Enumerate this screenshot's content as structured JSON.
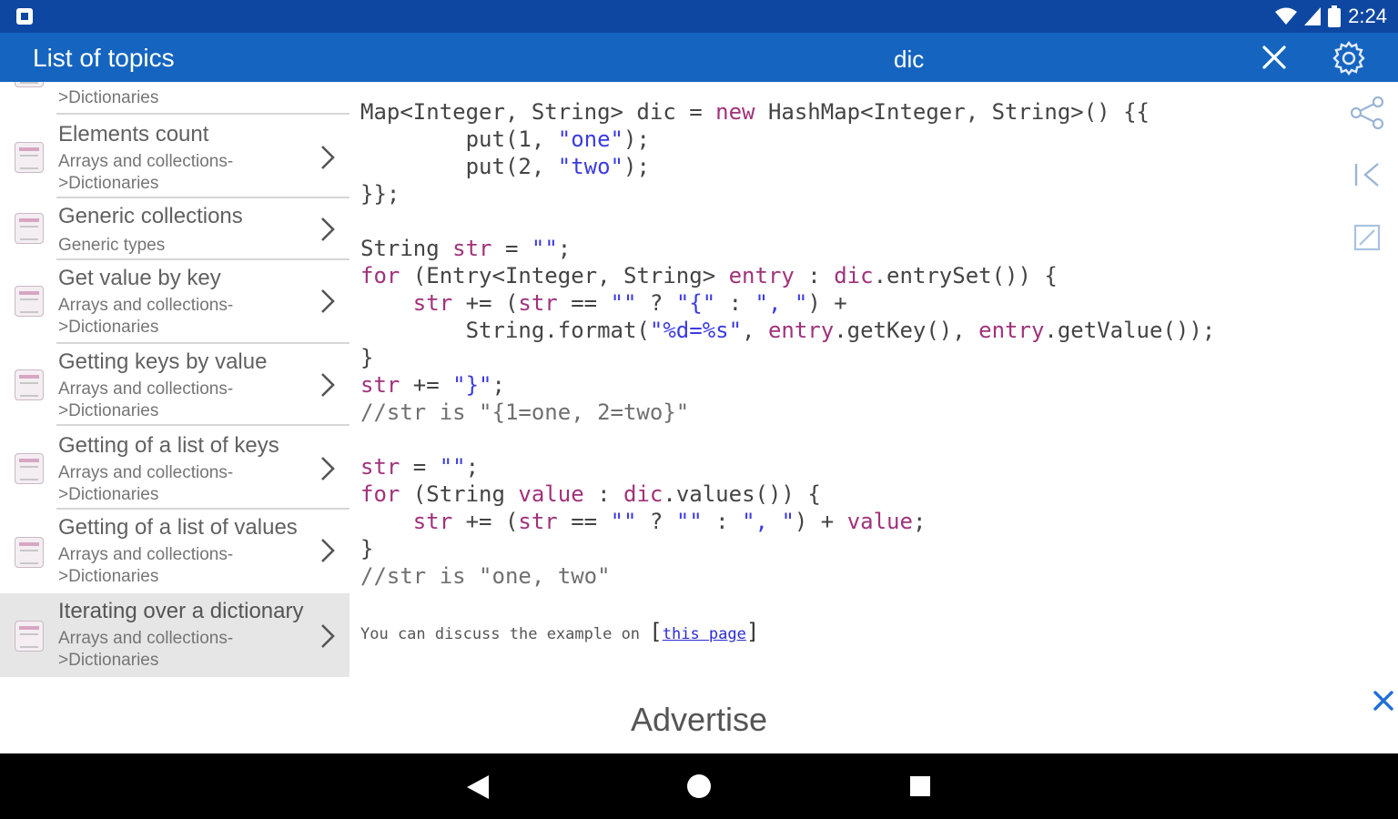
{
  "status_bar": {
    "time": "2:24"
  },
  "app_bar": {
    "title": "List of topics",
    "search_query": "dic"
  },
  "list": {
    "items": [
      {
        "subtitle": ">Dictionaries"
      },
      {
        "title": "Elements count",
        "subtitle1": "Arrays and collections-",
        "subtitle2": ">Dictionaries"
      },
      {
        "title": "Generic collections",
        "subtitle1": "Generic types"
      },
      {
        "title": "Get value by key",
        "subtitle1": "Arrays and collections-",
        "subtitle2": ">Dictionaries"
      },
      {
        "title": "Getting keys by value",
        "subtitle1": "Arrays and collections-",
        "subtitle2": ">Dictionaries"
      },
      {
        "title": "Getting of a list of keys",
        "subtitle1": "Arrays and collections-",
        "subtitle2": ">Dictionaries"
      },
      {
        "title": "Getting of a list of values",
        "subtitle1": "Arrays and collections-",
        "subtitle2": ">Dictionaries"
      },
      {
        "title": "Iterating over a dictionary",
        "subtitle1": "Arrays and collections-",
        "subtitle2": ">Dictionaries"
      }
    ]
  },
  "code": {
    "l1": {
      "a": "Map<Integer, String> dic = ",
      "kw": "new",
      "b": " HashMap<Integer, String>() {{"
    },
    "l2": {
      "a": "        put(1, ",
      "s": "\"one\"",
      "b": ");"
    },
    "l3": {
      "a": "        put(2, ",
      "s": "\"two\"",
      "b": ");"
    },
    "l4": "}};",
    "l5": {
      "a": "String ",
      "kw": "str",
      "b": " = ",
      "s": "\"\"",
      "c": ";"
    },
    "l6": {
      "kw1": "for",
      "a": " (Entry<Integer, String> ",
      "kw2": "entry",
      "b": " : ",
      "kw3": "dic",
      "c": ".entrySet()) {"
    },
    "l7": {
      "a": "    ",
      "kw": "str",
      "b": " += (",
      "kw2": "str",
      "c": " == ",
      "s1": "\"\"",
      "d": " ? ",
      "s2": "\"{\"",
      "e": " : ",
      "s3": "\", \"",
      "f": ") +"
    },
    "l8": {
      "a": "        String.format(",
      "s": "\"%d=%s\"",
      "b": ", ",
      "kw": "entry",
      "c": ".getKey(), ",
      "kw2": "entry",
      "d": ".getValue());"
    },
    "l9": "}",
    "l10": {
      "kw": "str",
      "a": " += ",
      "s": "\"}\"",
      "b": ";"
    },
    "l11": "//str is \"{1=one, 2=two}\"",
    "l12": {
      "kw": "str",
      "a": " = ",
      "s": "\"\"",
      "b": ";"
    },
    "l13": {
      "kw1": "for",
      "a": " (String ",
      "kw2": "value",
      "b": " : ",
      "kw3": "dic",
      "c": ".values()) {"
    },
    "l14": {
      "a": "    ",
      "kw": "str",
      "b": " += (",
      "kw2": "str",
      "c": " == ",
      "s1": "\"\"",
      "d": " ? ",
      "s2": "\"\"",
      "e": " : ",
      "s3": "\", \"",
      "f": ") + ",
      "kw3": "value",
      "g": ";"
    },
    "l15": "}",
    "l16": "//str is \"one, two\""
  },
  "discuss": {
    "text": "You can discuss the example on ",
    "link": "this page"
  },
  "ad": {
    "label": "Advertise"
  },
  "colors": {
    "status": "#0d47a1",
    "appbar": "#1565c0",
    "keyword": "#a0327a",
    "string": "#3b3be0",
    "accent": "#1e6fd9"
  }
}
